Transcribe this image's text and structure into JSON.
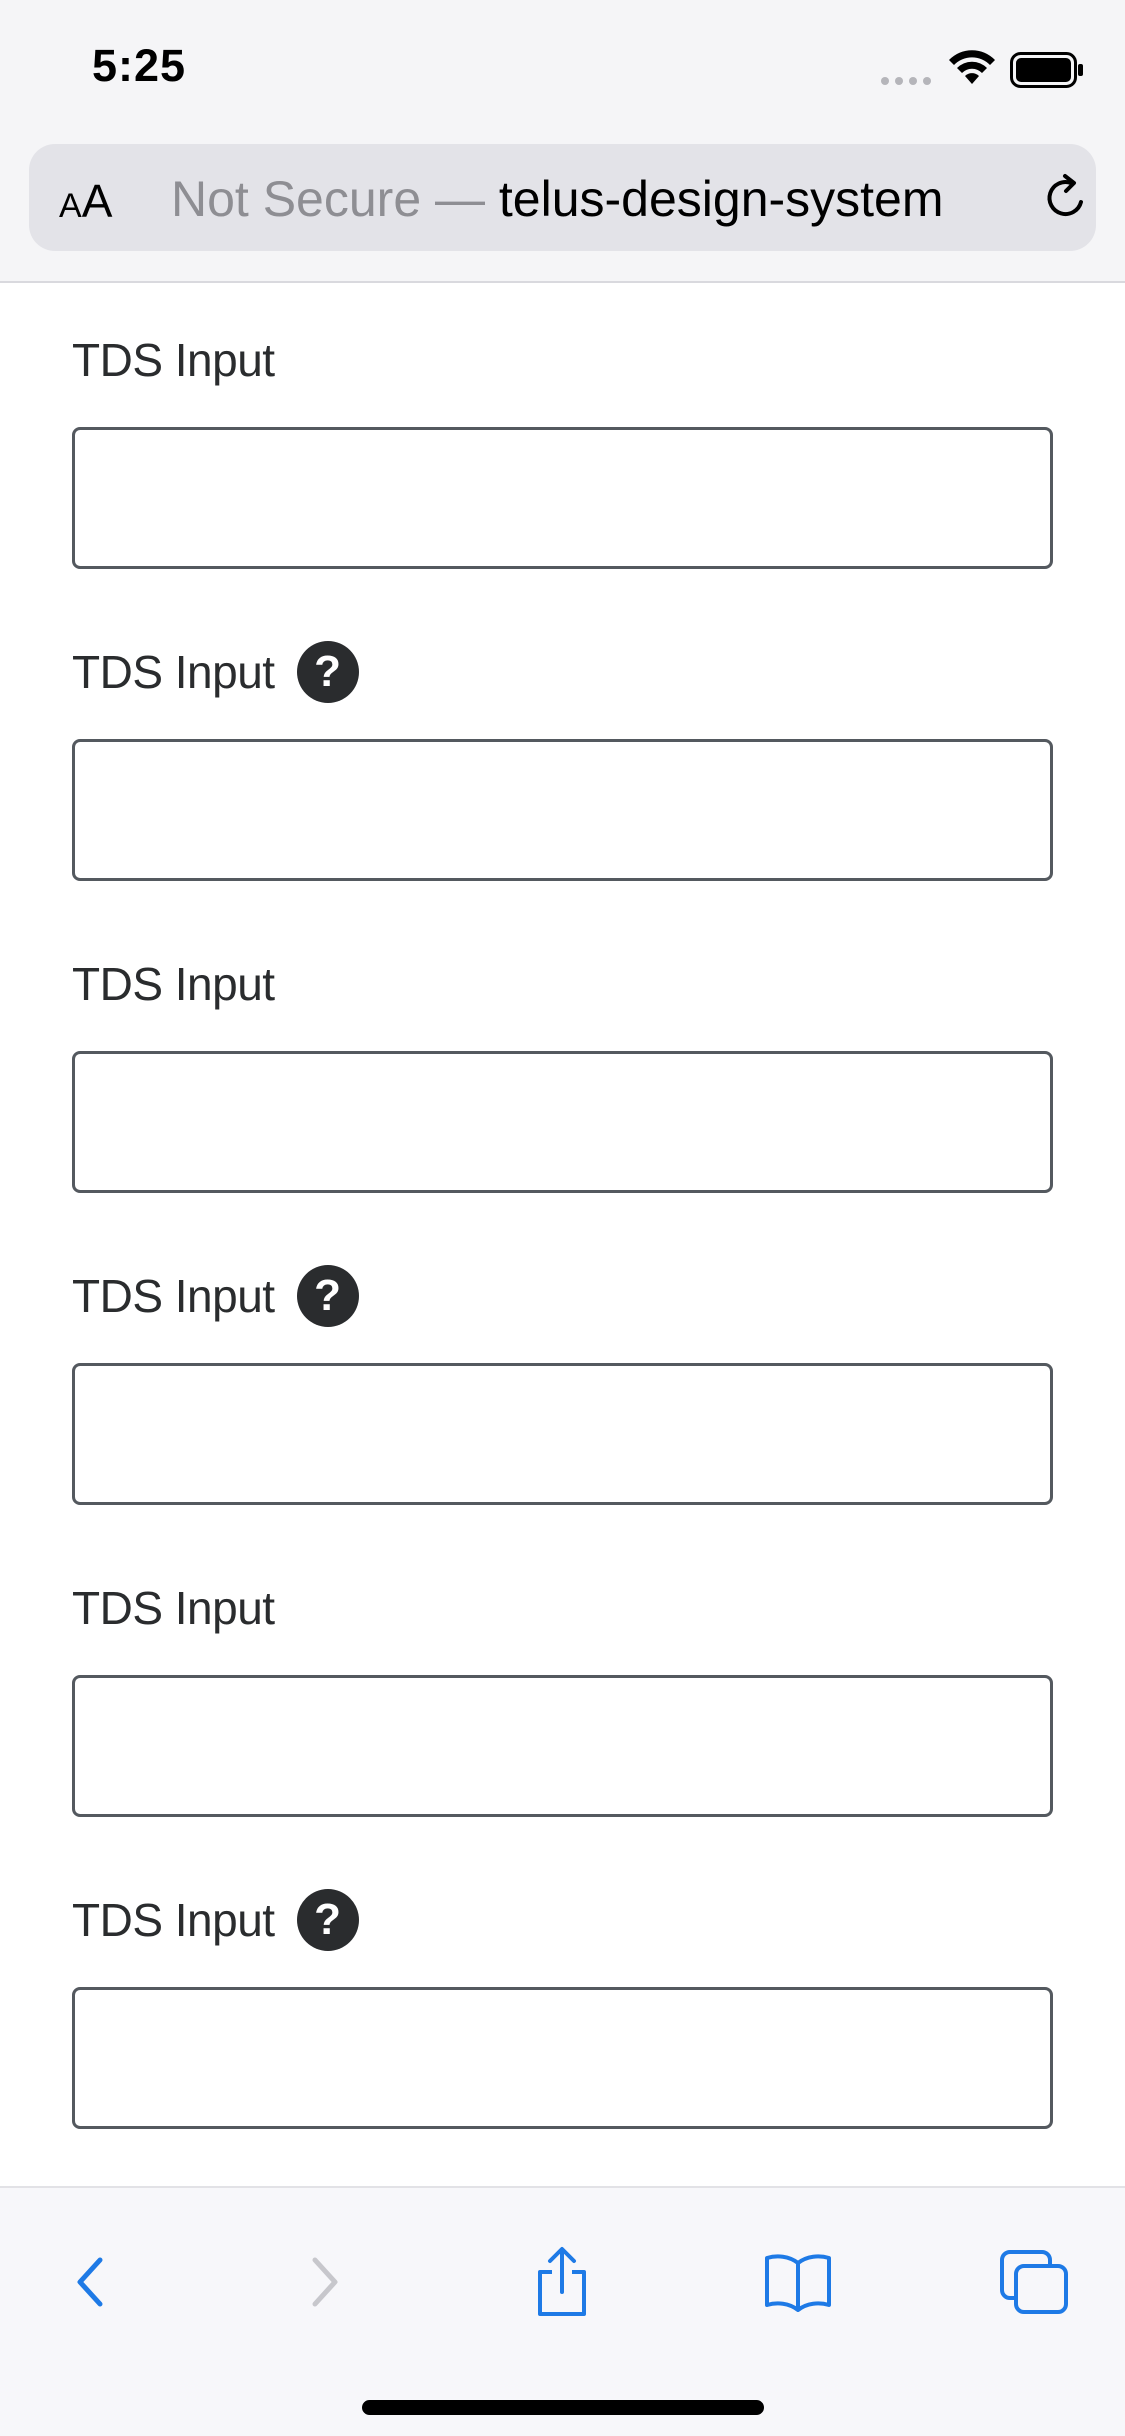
{
  "status_bar": {
    "time": "5:25"
  },
  "browser": {
    "aa_small": "A",
    "aa_large": "A",
    "url_secure": "Not Secure — ",
    "url_domain": "telus-design-system"
  },
  "form": {
    "fields": [
      {
        "label": "TDS Input",
        "has_help": false,
        "value": ""
      },
      {
        "label": "TDS Input",
        "has_help": true,
        "value": ""
      },
      {
        "label": "TDS Input",
        "has_help": false,
        "value": ""
      },
      {
        "label": "TDS Input",
        "has_help": true,
        "value": ""
      },
      {
        "label": "TDS Input",
        "has_help": false,
        "value": ""
      },
      {
        "label": "TDS Input",
        "has_help": true,
        "value": ""
      }
    ],
    "help_glyph": "?"
  },
  "toolbar": {
    "icons": [
      "back-icon",
      "forward-icon",
      "share-icon",
      "bookmarks-icon",
      "tabs-icon"
    ]
  },
  "colors": {
    "text": "#2a2c2e",
    "input_border": "#54595f",
    "ios_blue": "#1e7ae6",
    "disabled": "#c7c7cc"
  }
}
